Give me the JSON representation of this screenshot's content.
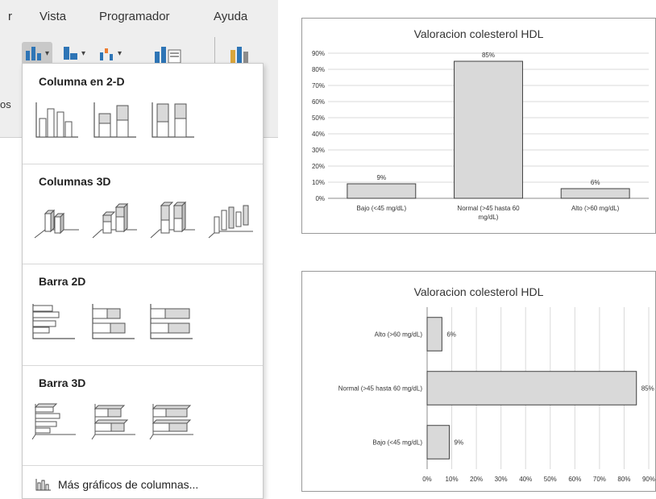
{
  "ribbon": {
    "tabs": [
      {
        "label": "r"
      },
      {
        "label": "Vista"
      },
      {
        "label": "Programador"
      },
      {
        "label": "Ayuda"
      }
    ],
    "truncated_text": "os"
  },
  "dropdown": {
    "sections": [
      {
        "title": "Columna en 2-D"
      },
      {
        "title": "Columnas 3D"
      },
      {
        "title": "Barra 2D"
      },
      {
        "title": "Barra 3D"
      }
    ],
    "more_link": "Más gráficos de columnas..."
  },
  "colors": {
    "bar_fill": "#d9d9d9",
    "bar_stroke": "#404040",
    "grid": "#d9d9d9",
    "ribbon_bg": "#eeeeee",
    "icon_blue": "#2e75b6",
    "icon_orange": "#ed7d31"
  },
  "chart_data": [
    {
      "type": "bar",
      "orientation": "vertical",
      "title": "Valoracion colesterol HDL",
      "categories": [
        "Bajo  (<45 mg/dL)",
        "Normal (>45 hasta 60 mg/dL)",
        "Alto (>60 mg/dL)"
      ],
      "category_lines": [
        [
          "Bajo  (<45 mg/dL)"
        ],
        [
          "Normal (>45 hasta 60",
          "mg/dL)"
        ],
        [
          "Alto (>60 mg/dL)"
        ]
      ],
      "values": [
        9,
        85,
        6
      ],
      "data_labels": [
        "9%",
        "85%",
        "6%"
      ],
      "ylim": [
        0,
        90
      ],
      "yticks": [
        "0%",
        "10%",
        "20%",
        "30%",
        "40%",
        "50%",
        "60%",
        "70%",
        "80%",
        "90%"
      ],
      "grid": true,
      "legend": "none"
    },
    {
      "type": "bar",
      "orientation": "horizontal",
      "title": "Valoracion colesterol HDL",
      "categories": [
        "Alto (>60 mg/dL)",
        "Normal (>45 hasta 60 mg/dL)",
        "Bajo  (<45 mg/dL)"
      ],
      "values": [
        6,
        85,
        9
      ],
      "data_labels": [
        "6%",
        "85%",
        "9%"
      ],
      "xlim": [
        0,
        90
      ],
      "xticks": [
        "0%",
        "10%",
        "20%",
        "30%",
        "40%",
        "50%",
        "60%",
        "70%",
        "80%",
        "90%"
      ],
      "grid": true,
      "legend": "none"
    }
  ]
}
